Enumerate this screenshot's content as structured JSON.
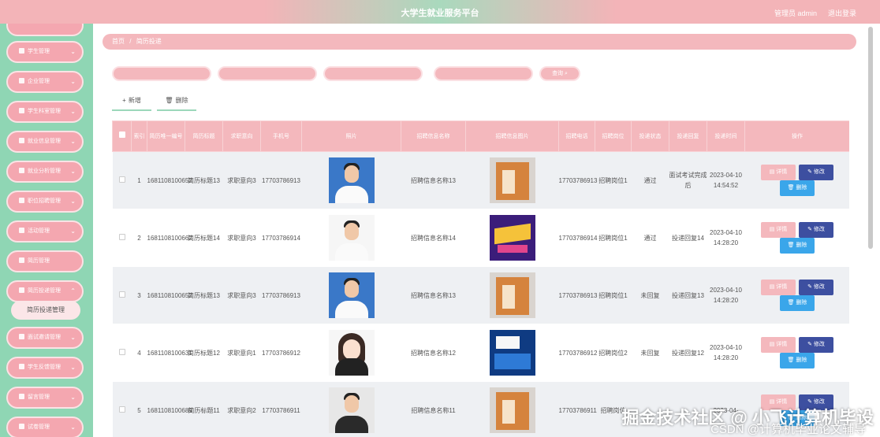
{
  "header": {
    "title": "大学生就业服务平台",
    "admin": "管理员 admin",
    "logout": "退出登录"
  },
  "sidebar": {
    "items": [
      {
        "label": ""
      },
      {
        "label": "学生管理"
      },
      {
        "label": "企业管理"
      },
      {
        "label": "学生科室管理"
      },
      {
        "label": "就业信息管理"
      },
      {
        "label": "就业分析管理"
      },
      {
        "label": "职位招聘管理"
      },
      {
        "label": "活动管理"
      },
      {
        "label": "简历管理"
      },
      {
        "label": "简历投递管理"
      },
      {
        "label": "面试邀请管理"
      },
      {
        "label": "学生反馈管理"
      },
      {
        "label": "留言管理"
      },
      {
        "label": "试卷管理"
      }
    ],
    "active_sub": "简历投递管理"
  },
  "breadcrumb": {
    "home": "首页",
    "sep": "/",
    "current": "简历投递"
  },
  "search": {
    "button": "查询"
  },
  "actions": {
    "add": "新增",
    "delete": "删除"
  },
  "table": {
    "headers": [
      "索引",
      "简历唯一编号",
      "简历标题",
      "求职意向",
      "手机号",
      "照片",
      "招聘信息名称",
      "招聘信息图片",
      "招聘电话",
      "招聘岗位",
      "投递状态",
      "投递回复",
      "投递时间",
      "操作"
    ],
    "rows": [
      {
        "index": "1",
        "code": "1681108100652",
        "title": "简历标题13",
        "intent": "求职意向3",
        "phone": "17703786913",
        "photo": "male-blue",
        "job_name": "招聘信息名称13",
        "poster": "orange",
        "job_phone": "17703786913",
        "post": "招聘岗位1",
        "status": "通过",
        "reply": "面试考试完成后",
        "time": "2023-04-10 14:54:52"
      },
      {
        "index": "2",
        "code": "1681108100662",
        "title": "简历标题14",
        "intent": "求职意向3",
        "phone": "17703786914",
        "photo": "male-white",
        "job_name": "招聘信息名称14",
        "poster": "purple",
        "job_phone": "17703786914",
        "post": "招聘岗位1",
        "status": "通过",
        "reply": "投递回复14",
        "time": "2023-04-10 14:28:20"
      },
      {
        "index": "3",
        "code": "1681108100652",
        "title": "简历标题13",
        "intent": "求职意向3",
        "phone": "17703786913",
        "photo": "male-blue",
        "job_name": "招聘信息名称13",
        "poster": "orange",
        "job_phone": "17703786913",
        "post": "招聘岗位1",
        "status": "未回复",
        "reply": "投递回复13",
        "time": "2023-04-10 14:28:20"
      },
      {
        "index": "4",
        "code": "1681108100631",
        "title": "简历标题12",
        "intent": "求职意向1",
        "phone": "17703786912",
        "photo": "female",
        "job_name": "招聘信息名称12",
        "poster": "darkblue",
        "job_phone": "17703786912",
        "post": "招聘岗位2",
        "status": "未回复",
        "reply": "投递回复12",
        "time": "2023-04-10 14:28:20"
      },
      {
        "index": "5",
        "code": "1681108100689",
        "title": "简历标题11",
        "intent": "求职意向2",
        "phone": "17703786911",
        "photo": "male-suit",
        "job_name": "招聘信息名称11",
        "poster": "orange",
        "job_phone": "17703786911",
        "post": "招聘岗位",
        "status": "",
        "reply": "",
        "time": "2023-04-"
      }
    ],
    "buttons": {
      "detail": "详情",
      "edit": "修改",
      "delete": "删除"
    }
  },
  "watermark": {
    "line1": "掘金技术社区 @ 小飞计算机毕设",
    "line2": "CSDN @计算机毕业论文辅导"
  }
}
